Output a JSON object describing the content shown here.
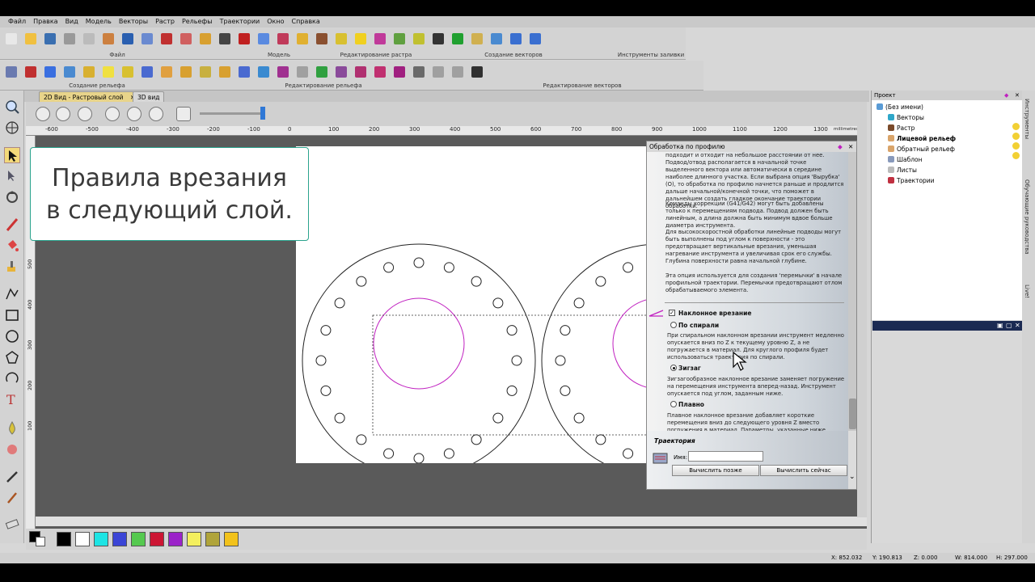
{
  "menu": [
    "Файл",
    "Правка",
    "Вид",
    "Модель",
    "Векторы",
    "Растр",
    "Рельефы",
    "Траектории",
    "Окно",
    "Справка"
  ],
  "toolbar_groups": {
    "row1": [
      "Файл",
      "Модель",
      "Редактирование растра",
      "Создание векторов",
      "Инструменты заливки"
    ],
    "row2": [
      "Создание рельефа",
      "Редактирование рельефа",
      "Редактирование векторов"
    ]
  },
  "tabs": {
    "tab_2d": "2D Вид - Растровый слой",
    "tab_3d": "3D вид"
  },
  "ruler_h": [
    "-600",
    "-500",
    "-400",
    "-300",
    "-200",
    "-100",
    "0",
    "100",
    "200",
    "300",
    "400",
    "500",
    "600",
    "700",
    "800",
    "900",
    "1000",
    "1100",
    "1200",
    "1300"
  ],
  "ruler_unit": "millimetres",
  "ruler_v": [
    "500",
    "400",
    "300",
    "200",
    "100"
  ],
  "callout": {
    "line1": "Правила врезания",
    "line2": "в следующий слой."
  },
  "dialog": {
    "title": "Обработка по профилю",
    "para1": "подходит и отходит на небольшое расстоянии от нее. Подвод/отвод располагается в начальной точке выделенного вектора или автоматически в середине наиболее длинного участка. Если выбрана опция 'Вырубка' (O), то обработка по профилю начнется раньше и продлится дальше начальной/конечной точки, что поможет в дальнейшем создать гладкое окончание траектории обработки.",
    "para2": "Команды коррекции (G41/G42) могут быть добавлены только к перемещениям подвода. Подвод должен быть линейным, а длина должна быть минимум вдвое больше диаметра инструмента.",
    "para3": "Для высокоскоростной обработки линейные подводы могут быть выполнены под углом к поверхности - это предотвращает вертикальные врезания, уменьшая нагревание инструмента и увеличивая срок его службы. Глубина поверхности равна начальной глубине.",
    "para4": "Эта опция используется для создания 'перемычки' в начале профильной траектории. Перемычки предотвращают отлом обрабатываемого элемента.",
    "ramp_label": "Наклонное врезание",
    "opt_spiral": "По спирали",
    "desc_spiral": "При спиральном наклонном врезании инструмент медленно опускается вниз по Z к текущему уровню Z, а не погружается в материал. Для круглого профиля будет использоваться траектория по спирали.",
    "opt_zigzag": "Зигзаг",
    "desc_zigzag": "Зигзагообразное наклонное врезание заменяет погружение на перемещения инструмента вперед-назад. Инструмент опускается под углом, заданным ниже.",
    "opt_smooth": "Плавно",
    "desc_smooth": "Плавное наклонное врезание добавляет короткие перемещения вниз до следующего уровня Z вместо погружения в материал. Параметры, указанные ниже,",
    "traj_header": "Траектория",
    "name_label": "Имя:",
    "name_value": "",
    "btn_later": "Вычислить позже",
    "btn_now": "Вычислить сейчас"
  },
  "project": {
    "title": "Проект",
    "items": [
      "(Без имени)",
      "Векторы",
      "Растр",
      "Лицевой рельеф",
      "Обратный рельеф",
      "Шаблон",
      "Листы",
      "Траектории"
    ]
  },
  "side_tabs": [
    "Инструменты",
    "Обучающие руководства",
    "Live!"
  ],
  "palette": [
    "#000000",
    "#ffffff",
    "#1de4e4",
    "#3b45d6",
    "#55c94f",
    "#cc1533",
    "#9b22c9",
    "#f3ef5e",
    "#b0a43a",
    "#f2c21b"
  ],
  "status": {
    "x": "X: 852.032",
    "y": "Y: 190.813",
    "z": "Z: 0.000",
    "w": "W: 814.000",
    "h": "H: 297.000"
  },
  "colors": {
    "accent": "#2ba38d",
    "selection": "#c020c0"
  }
}
